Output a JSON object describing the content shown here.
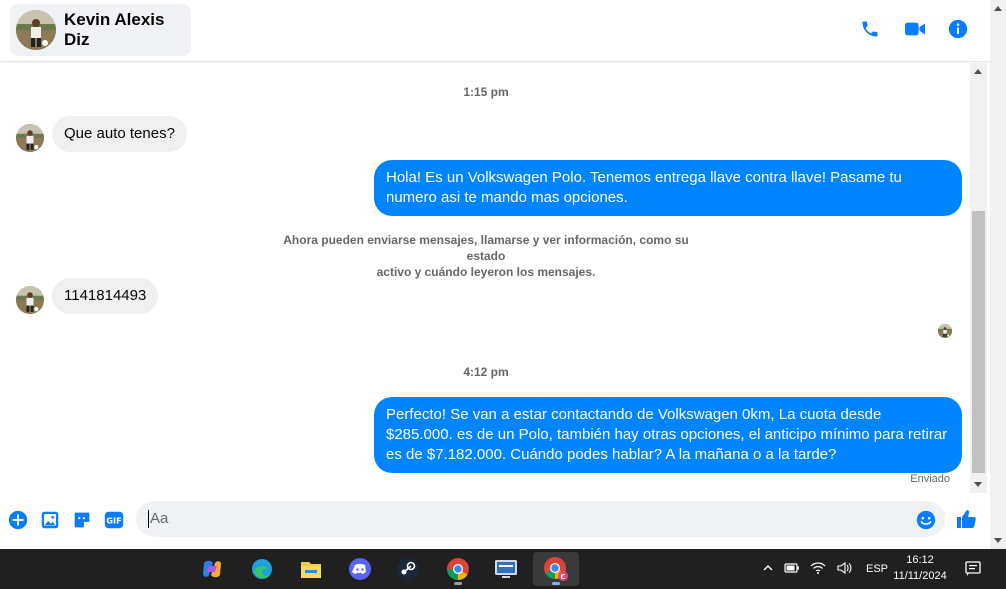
{
  "header": {
    "contact_name": "Kevin Alexis Diz"
  },
  "chat": {
    "timestamp_1": "1:15 pm",
    "timestamp_2": "4:12 pm",
    "messages": [
      {
        "direction": "in",
        "text": "Que auto tenes?"
      },
      {
        "direction": "out",
        "text": "Hola! Es un Volkswagen Polo. Tenemos entrega llave contra llave! Pasame tu numero asi te mando mas opciones."
      },
      {
        "direction": "in",
        "text": "1141814493"
      },
      {
        "direction": "out",
        "text": "Perfecto!  Se van a estar contactando de Volkswagen 0km, La cuota desde $285.000. es de un Polo, también hay otras opciones, el anticipo mínimo para retirar es de $7.182.000. Cuándo podes hablar? A la mañana o a la tarde?"
      }
    ],
    "notice_line1": "Ahora pueden enviarse mensajes, llamarse y ver información, como su estado",
    "notice_line2": "activo y cuándo leyeron los mensajes.",
    "status": "Enviado"
  },
  "composer": {
    "placeholder": "Aa"
  },
  "taskbar": {
    "language": "ESP",
    "time": "16:12",
    "date": "11/11/2024"
  },
  "colors": {
    "accent": "#0084ff",
    "incoming_bubble": "#f0f0f0",
    "taskbar": "#202020"
  }
}
